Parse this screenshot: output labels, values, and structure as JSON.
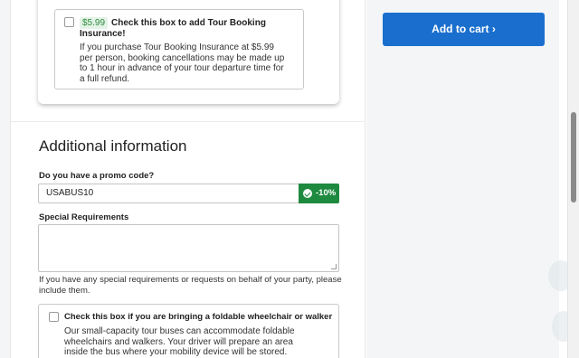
{
  "insurance": {
    "price": "$5.99",
    "title": "Check this box to add Tour Booking Insurance!",
    "description": "If you purchase Tour Booking Insurance at $5.99 per person, booking cancellations may be made up to 1 hour in advance of your tour departure time for a full refund.",
    "checked": false
  },
  "additional_info": {
    "heading": "Additional information",
    "promo_label": "Do you have a promo code?",
    "promo_value": "USABUS10",
    "discount": "-10%",
    "discount_color": "#1e8a3f",
    "special_label": "Special Requirements",
    "special_value": "",
    "special_help": "If you have any special requirements or requests on behalf of your party, please include them.",
    "wheelchair_title": "Check this box if you are bringing a foldable wheelchair or walker",
    "wheelchair_desc": "Our small-capacity tour buses can accommodate foldable wheelchairs and walkers. Your driver will prepare an area inside the bus where your mobility device will be stored. However, if you",
    "wheelchair_checked": false
  },
  "cart": {
    "label": "Add to cart ›",
    "color": "#1a6fce"
  }
}
